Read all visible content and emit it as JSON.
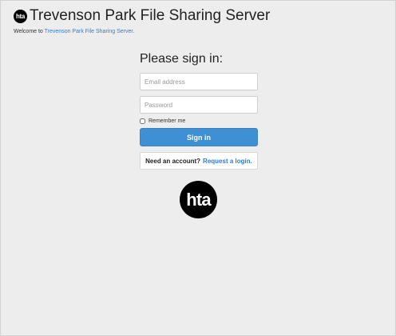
{
  "header": {
    "logo_text": "hta",
    "title": "Trevenson Park File Sharing Server",
    "welcome_prefix": "Welcome to",
    "welcome_link": "Trevenson Park File Sharing Server."
  },
  "signin": {
    "heading": "Please sign in:",
    "email_placeholder": "Email address",
    "password_placeholder": "Password",
    "remember_label": "Remember me",
    "button_label": "Sign in",
    "account_prompt": "Need an account?",
    "request_link": "Request a login."
  },
  "footer": {
    "logo_text": "hta"
  },
  "colors": {
    "background": "#ededed",
    "link": "#2a7fd6",
    "button": "#3f8fd4"
  }
}
